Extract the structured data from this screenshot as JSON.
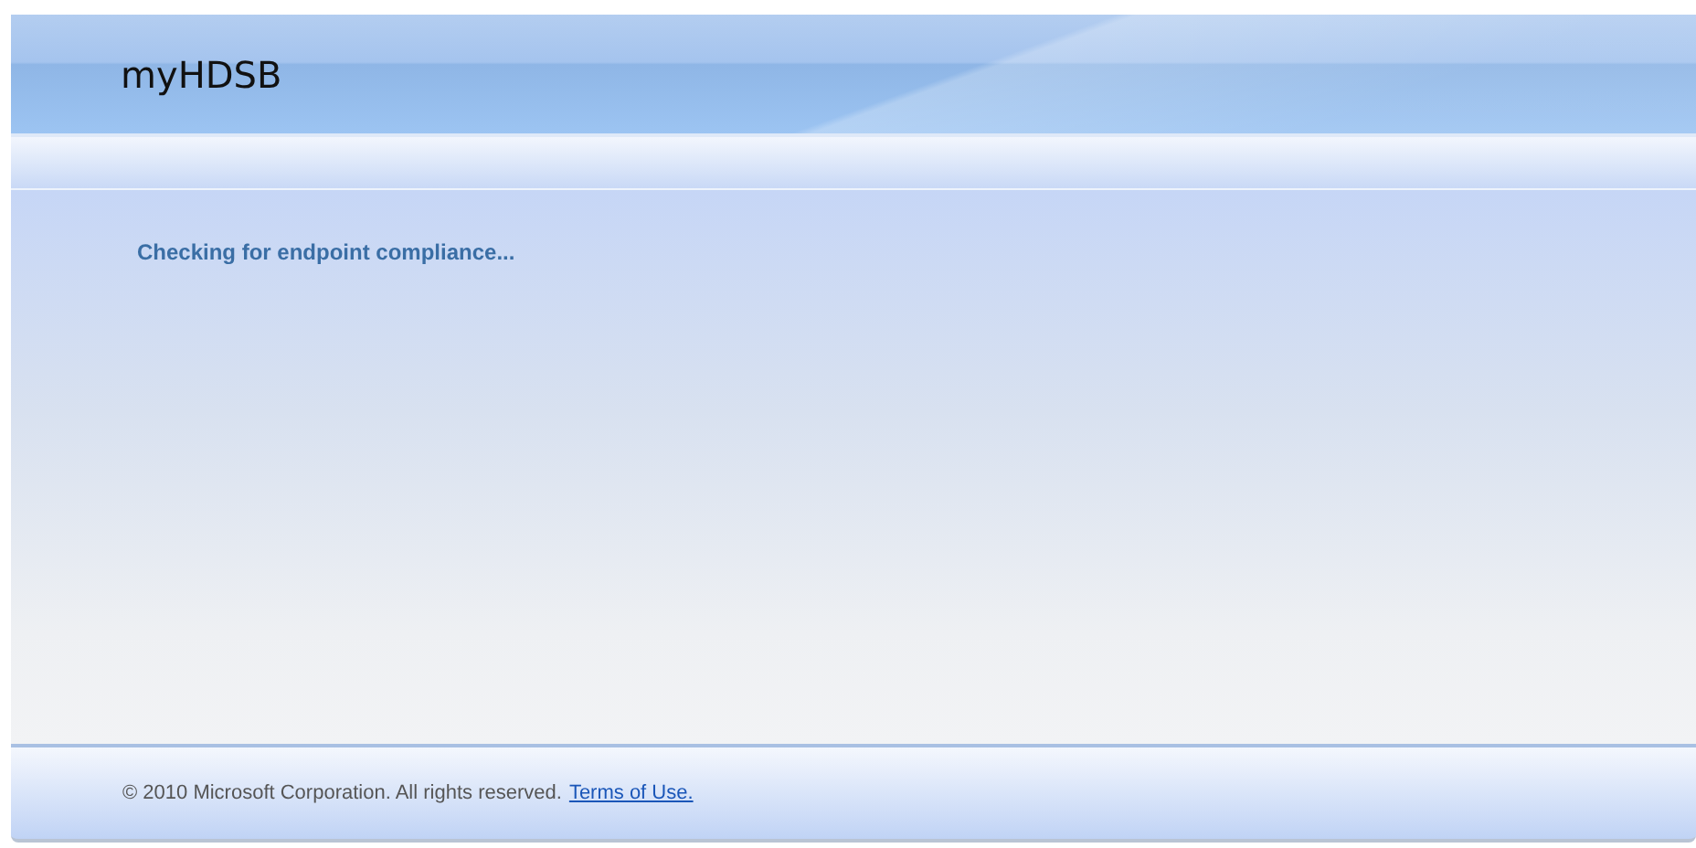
{
  "header": {
    "title": "myHDSB"
  },
  "content": {
    "status": "Checking for endpoint compliance..."
  },
  "footer": {
    "copyright": "© 2010 Microsoft Corporation. All rights reserved.",
    "link": "Terms of Use."
  }
}
